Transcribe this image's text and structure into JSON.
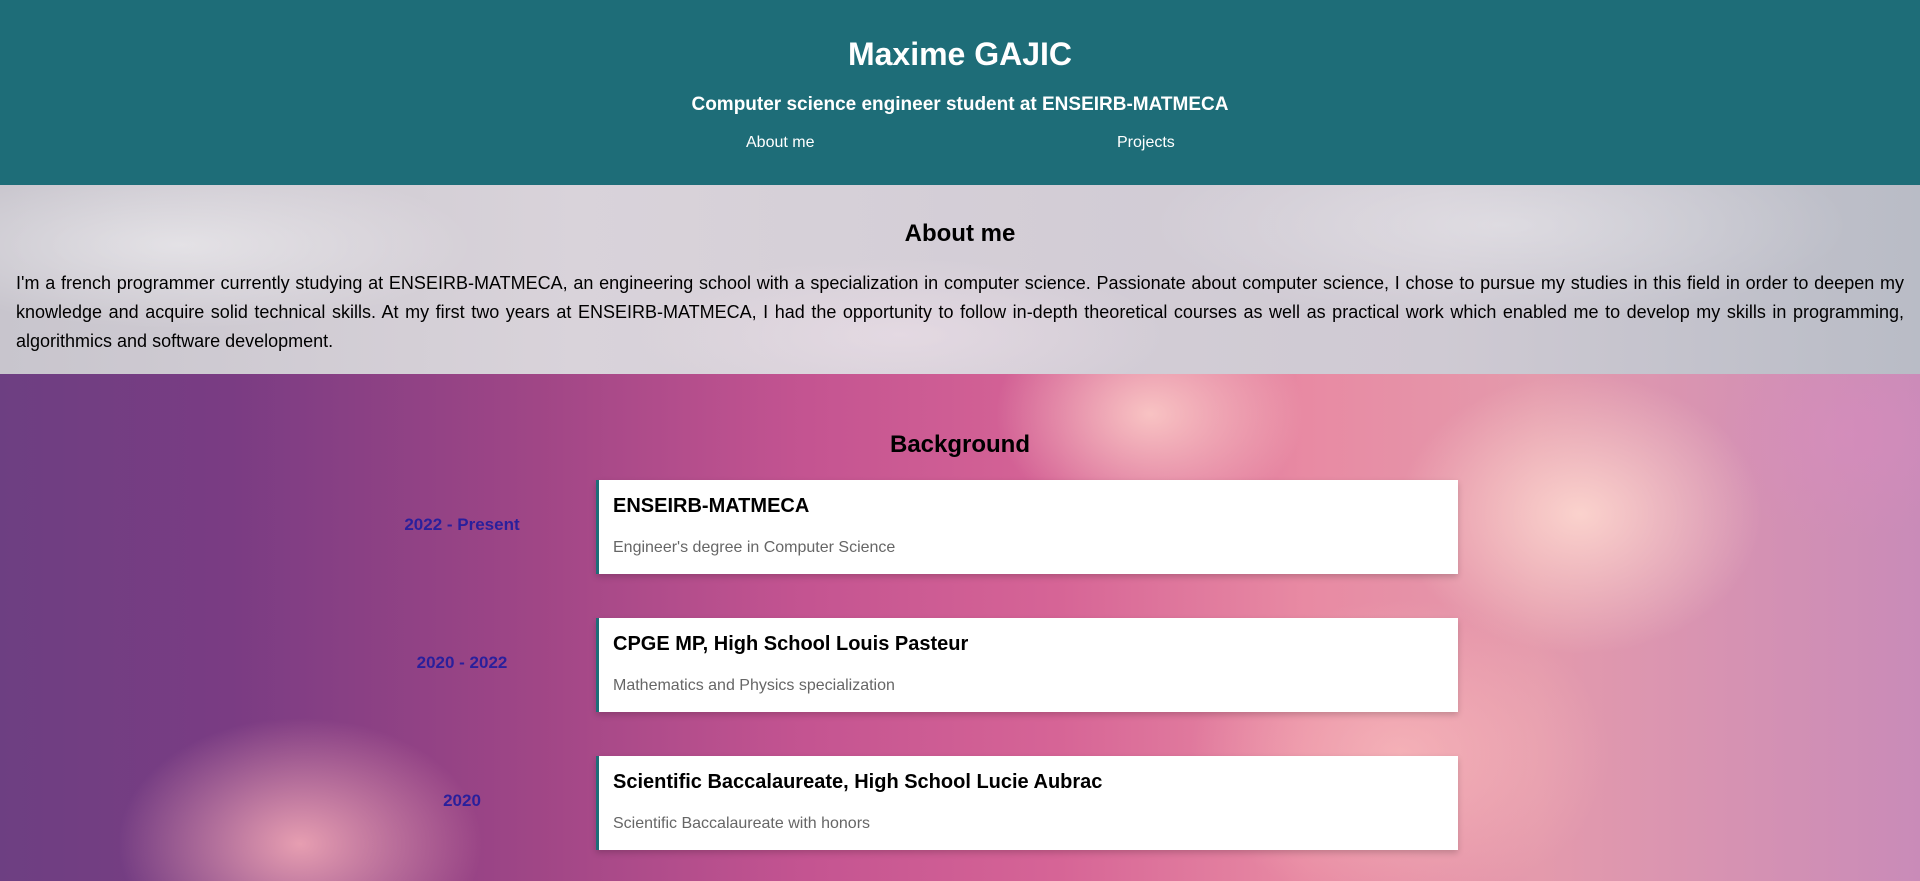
{
  "header": {
    "title": "Maxime GAJIC",
    "subtitle": "Computer science engineer student at ENSEIRB-MATMECA",
    "nav": [
      "About me",
      "Projects"
    ],
    "bg_color": "#1e6d78"
  },
  "about": {
    "title": "About me",
    "text": "I'm a french programmer currently studying at ENSEIRB-MATMECA, an engineering school with a specialization in computer science. Passionate about computer science, I chose to pursue my studies in this field in order to deepen my knowledge and acquire solid technical skills. At my first two years at ENSEIRB-MATMECA, I had the opportunity to follow in-depth theoretical courses as well as practical work which enabled me to develop my skills in programming, algorithmics and software development."
  },
  "background": {
    "title": "Background",
    "date_color": "#2a1f9c",
    "items": [
      {
        "date": "2022 - Present",
        "title": "ENSEIRB-MATMECA",
        "description": "Engineer's degree in Computer Science"
      },
      {
        "date": "2020 - 2022",
        "title": "CPGE MP, High School Louis Pasteur",
        "description": "Mathematics and Physics specialization"
      },
      {
        "date": "2020",
        "title": "Scientific Baccalaureate, High School Lucie Aubrac",
        "description": "Scientific Baccalaureate with honors"
      }
    ]
  }
}
